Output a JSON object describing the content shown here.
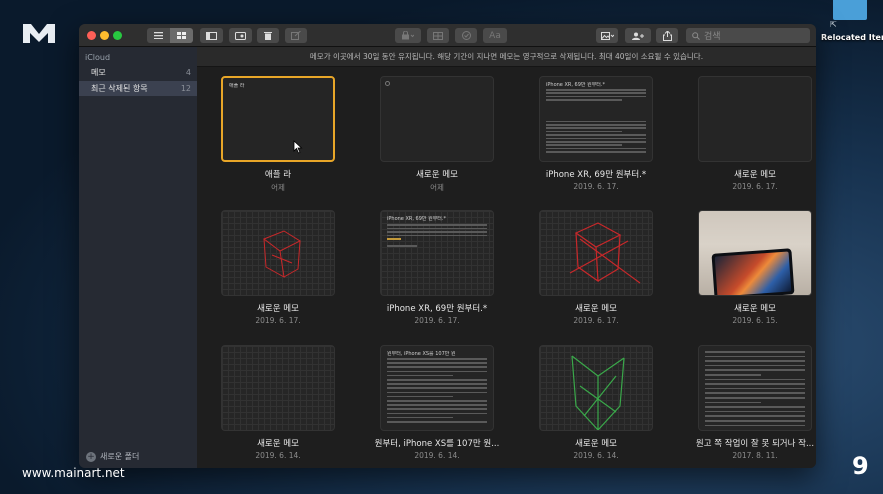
{
  "desktop": {
    "folder_label": "Relocated Items",
    "watermark": "www.mainart.net",
    "page_number": "9"
  },
  "toolbar": {
    "font_label": "Aa",
    "search_placeholder": "검색"
  },
  "sidebar": {
    "account": "iCloud",
    "items": [
      {
        "label": "메모",
        "count": "4",
        "active": false
      },
      {
        "label": "최근 삭제된 항목",
        "count": "12",
        "active": true
      }
    ],
    "new_folder_label": "새로운 폴더"
  },
  "banner": "메모가 이곳에서 30일 동안 유지됩니다. 해당 기간이 지나면 메모는 영구적으로 삭제됩니다. 최대 40일이 소요될 수 있습니다.",
  "notes": [
    {
      "title": "애플 라",
      "date": "어제",
      "thumb_text": "애플 라",
      "kind": "text",
      "selected": true
    },
    {
      "title": "새로운 메모",
      "date": "어제",
      "thumb_text": "",
      "kind": "blank",
      "selected": false
    },
    {
      "title": "iPhone XR, 69만 원부터.*",
      "date": "2019. 6. 17.",
      "thumb_text": "iPhone XR, 69만 원부터.*",
      "kind": "doc",
      "selected": false
    },
    {
      "title": "새로운 메모",
      "date": "2019. 6. 17.",
      "thumb_text": "",
      "kind": "blank",
      "selected": false
    },
    {
      "title": "새로운 메모",
      "date": "2019. 6. 17.",
      "thumb_text": "",
      "kind": "sketch-red",
      "selected": false
    },
    {
      "title": "iPhone XR, 69만 원부터.*",
      "date": "2019. 6. 17.",
      "thumb_text": "iPhone XR, 69만 원부터.*",
      "kind": "griddoc",
      "selected": false
    },
    {
      "title": "새로운 메모",
      "date": "2019. 6. 17.",
      "thumb_text": "",
      "kind": "sketch-red2",
      "selected": false
    },
    {
      "title": "새로운 메모",
      "date": "2019. 6. 15.",
      "thumb_text": "",
      "kind": "photo",
      "selected": false
    },
    {
      "title": "새로운 메모",
      "date": "2019. 6. 14.",
      "thumb_text": "",
      "kind": "gridblank",
      "selected": false
    },
    {
      "title": "원부터, iPhone XS를 107만 원...",
      "date": "2019. 6. 14.",
      "thumb_text": "원부터, iPhone XS를 107만 원",
      "kind": "doc2",
      "selected": false
    },
    {
      "title": "새로운 메모",
      "date": "2019. 6. 14.",
      "thumb_text": "",
      "kind": "sketch-green",
      "selected": false
    },
    {
      "title": "원고 쪽 작업이 잘 못 되거나 작...",
      "date": "2017. 8. 11.",
      "thumb_text": "",
      "kind": "list",
      "selected": false
    }
  ],
  "colors": {
    "selection": "#e8a628",
    "sidebar_bg": "#262a33",
    "sidebar_active": "#3b4150",
    "sketch_red": "#c8282a",
    "sketch_green": "#3aa84a"
  }
}
